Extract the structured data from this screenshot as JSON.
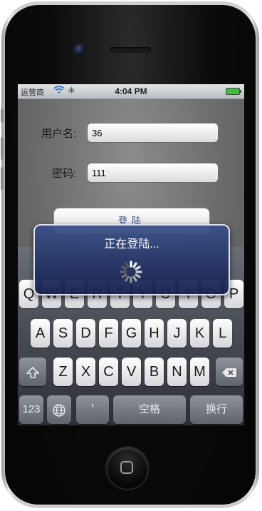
{
  "status_bar": {
    "carrier": "运营商",
    "time": "4:04 PM"
  },
  "login_form": {
    "username_label": "用户名:",
    "username_value": "36",
    "password_label": "密码:",
    "password_value": "111",
    "login_button": "登陆"
  },
  "hud": {
    "message": "正在登陆..."
  },
  "keyboard": {
    "row1": [
      "Q",
      "W",
      "E",
      "R",
      "T",
      "Y",
      "U",
      "I",
      "O",
      "P"
    ],
    "row2": [
      "A",
      "S",
      "D",
      "F",
      "G",
      "H",
      "J",
      "K",
      "L"
    ],
    "row3": [
      "Z",
      "X",
      "C",
      "V",
      "B",
      "N",
      "M"
    ],
    "numbers_key": "123",
    "apostrophe_key": "’",
    "space_key": "空格",
    "return_key": "换行"
  },
  "icons": [
    "camera-icon",
    "speaker-icon",
    "home-button-icon",
    "wifi-icon",
    "activity-spinner-icon",
    "battery-icon",
    "shift-icon",
    "delete-icon",
    "globe-icon"
  ]
}
